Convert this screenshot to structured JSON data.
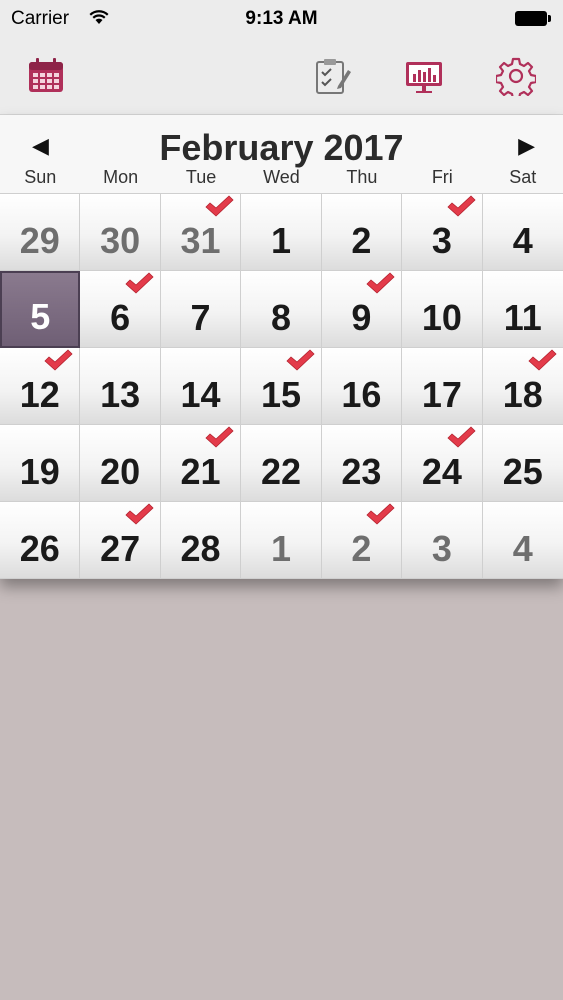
{
  "status_bar": {
    "carrier": "Carrier",
    "time": "9:13 AM"
  },
  "toolbar": {
    "icons": [
      "calendar-icon",
      "checklist-icon",
      "chart-icon",
      "gear-icon"
    ],
    "accent_color": "#b0305a"
  },
  "calendar": {
    "title": "February 2017",
    "prev_label": "◀",
    "next_label": "▶",
    "weekdays": [
      "Sun",
      "Mon",
      "Tue",
      "Wed",
      "Thu",
      "Fri",
      "Sat"
    ],
    "selected_day": 5,
    "check_color": "#e33b4a",
    "selected_color": "#6f5f75",
    "days": [
      {
        "day": "29",
        "month": "other",
        "checked": false
      },
      {
        "day": "30",
        "month": "other",
        "checked": false
      },
      {
        "day": "31",
        "month": "other",
        "checked": true
      },
      {
        "day": "1",
        "month": "current",
        "checked": false
      },
      {
        "day": "2",
        "month": "current",
        "checked": false
      },
      {
        "day": "3",
        "month": "current",
        "checked": true
      },
      {
        "day": "4",
        "month": "current",
        "checked": false
      },
      {
        "day": "5",
        "month": "current",
        "checked": false,
        "selected": true
      },
      {
        "day": "6",
        "month": "current",
        "checked": true
      },
      {
        "day": "7",
        "month": "current",
        "checked": false
      },
      {
        "day": "8",
        "month": "current",
        "checked": false
      },
      {
        "day": "9",
        "month": "current",
        "checked": true
      },
      {
        "day": "10",
        "month": "current",
        "checked": false
      },
      {
        "day": "11",
        "month": "current",
        "checked": false
      },
      {
        "day": "12",
        "month": "current",
        "checked": true
      },
      {
        "day": "13",
        "month": "current",
        "checked": false
      },
      {
        "day": "14",
        "month": "current",
        "checked": false
      },
      {
        "day": "15",
        "month": "current",
        "checked": true
      },
      {
        "day": "16",
        "month": "current",
        "checked": false
      },
      {
        "day": "17",
        "month": "current",
        "checked": false
      },
      {
        "day": "18",
        "month": "current",
        "checked": true
      },
      {
        "day": "19",
        "month": "current",
        "checked": false
      },
      {
        "day": "20",
        "month": "current",
        "checked": false
      },
      {
        "day": "21",
        "month": "current",
        "checked": true
      },
      {
        "day": "22",
        "month": "current",
        "checked": false
      },
      {
        "day": "23",
        "month": "current",
        "checked": false
      },
      {
        "day": "24",
        "month": "current",
        "checked": true
      },
      {
        "day": "25",
        "month": "current",
        "checked": false
      },
      {
        "day": "26",
        "month": "current",
        "checked": false
      },
      {
        "day": "27",
        "month": "current",
        "checked": true
      },
      {
        "day": "28",
        "month": "current",
        "checked": false
      },
      {
        "day": "1",
        "month": "other",
        "checked": false
      },
      {
        "day": "2",
        "month": "other",
        "checked": true
      },
      {
        "day": "3",
        "month": "other",
        "checked": false
      },
      {
        "day": "4",
        "month": "other",
        "checked": false
      }
    ]
  }
}
